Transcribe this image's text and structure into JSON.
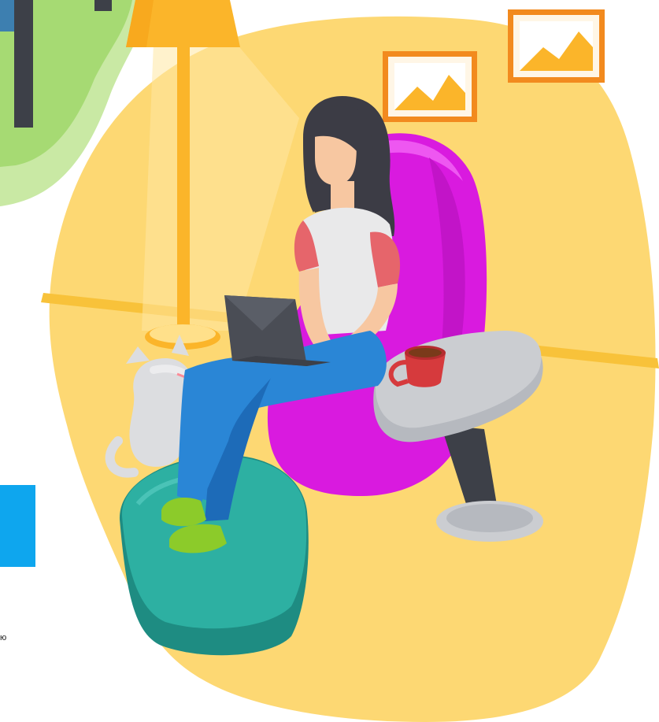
{
  "scene": {
    "edge_text": "ю",
    "colors": {
      "background": "#ffffff",
      "yellow_blob": "#FDD873",
      "yellow_dark": "#F8C23A",
      "lamp": "#FBB52A",
      "lamp_light": "#FFE8A3",
      "chair_magenta": "#D91ADF",
      "chair_magenta_light": "#EE57F1",
      "cushion": "#2DB0A2",
      "cushion_dark": "#1E8C82",
      "jeans": "#2A86D6",
      "jeans_dark": "#1D6BB8",
      "tshirt": "#E9E9EA",
      "sleeve": "#E6656B",
      "skin": "#F7C7A1",
      "hair": "#3C3C45",
      "laptop": "#4A4D55",
      "table": "#CBCDD1",
      "table_dark": "#3D4048",
      "mug": "#D63A3D",
      "socks": "#8CCB2A",
      "cat": "#DCDDE0",
      "frame": "#F28A1E",
      "frame_bg": "#FFF6E6",
      "mountain": "#FBB52A",
      "green_blob": "#A6DA73",
      "green_light": "#C9E9A4",
      "blue_panel": "#0EA6EE"
    }
  }
}
